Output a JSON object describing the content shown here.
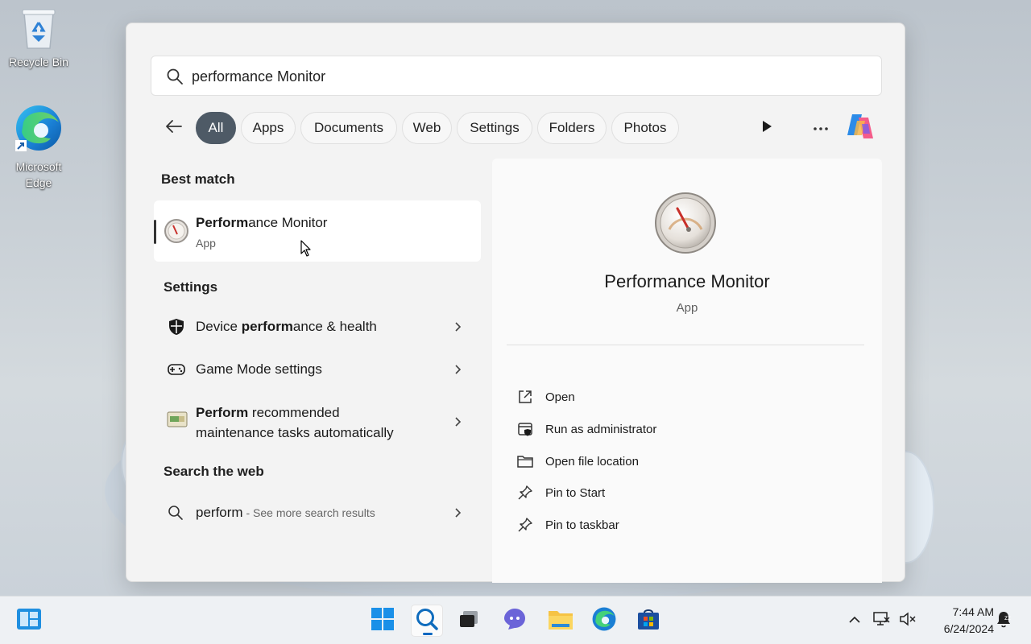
{
  "desktop": {
    "icons": [
      {
        "label": "Recycle Bin",
        "icon": "recycle-bin-icon"
      },
      {
        "label": "Microsoft Edge",
        "icon": "edge-icon"
      }
    ]
  },
  "search": {
    "value": "performance Monitor",
    "placeholder": ""
  },
  "filters": {
    "back_icon": "back-arrow-icon",
    "chips": [
      "All",
      "Apps",
      "Documents",
      "Web",
      "Settings",
      "Folders",
      "Photos"
    ],
    "active": "All"
  },
  "best_match": {
    "heading": "Best match",
    "title_bold": "Perform",
    "title_rest": "ance Monitor",
    "subtitle": "App"
  },
  "settings": {
    "heading": "Settings",
    "items": [
      {
        "pre": "Device ",
        "bold": "perform",
        "post": "ance & health",
        "icon": "shield-icon"
      },
      {
        "pre": "Game Mode settings",
        "bold": "",
        "post": "",
        "icon": "gamepad-icon"
      },
      {
        "pre": "",
        "bold": "Perform",
        "post": " recommended",
        "line2": "maintenance tasks automatically",
        "icon": "maintenance-icon"
      }
    ]
  },
  "web": {
    "heading": "Search the web",
    "query": "perform",
    "suffix": " - See more search results"
  },
  "detail": {
    "title": "Performance Monitor",
    "subtitle": "App",
    "actions": [
      {
        "label": "Open",
        "icon": "open-external-icon"
      },
      {
        "label": "Run as administrator",
        "icon": "admin-shield-icon"
      },
      {
        "label": "Open file location",
        "icon": "folder-icon"
      },
      {
        "label": "Pin to Start",
        "icon": "pin-icon"
      },
      {
        "label": "Pin to taskbar",
        "icon": "pin-icon"
      }
    ]
  },
  "taskbar": {
    "time": "7:44 AM",
    "date": "6/24/2024"
  },
  "colors": {
    "accent": "#0067c0",
    "chip_active": "#4e5a66"
  }
}
